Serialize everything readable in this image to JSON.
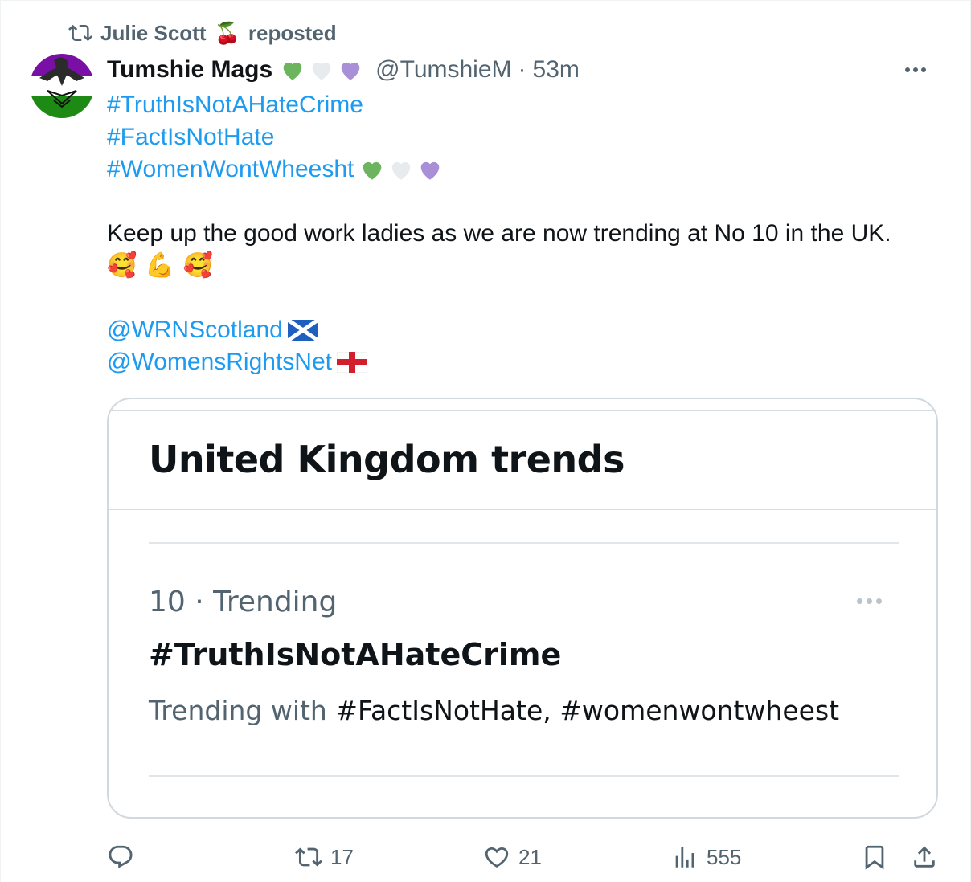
{
  "social_context": {
    "user": "Julie Scott",
    "emoji": "🍒",
    "action": "reposted",
    "icon": "repost-icon"
  },
  "author": {
    "name": "Tumshie Mags",
    "handle": "@TumshieM",
    "separator": "·",
    "time": "53m",
    "name_hearts": [
      "#6cb45e",
      "#e8ebed",
      "#a98fd8"
    ]
  },
  "tweet": {
    "hashtag1": "#TruthIsNotAHateCrime",
    "hashtag2": "#FactIsNotHate",
    "hashtag3": "#WomenWontWheesht",
    "text": "Keep up the good work ladies as we are now trending at No 10 in the UK.",
    "emojis": [
      "🥰",
      "💪",
      "🥰"
    ],
    "mention1": "@WRNScotland",
    "mention2": "@WomensRightsNet"
  },
  "card": {
    "title": "United Kingdom trends",
    "rank": "10 · Trending",
    "trend": "#TruthIsNotAHateCrime",
    "with_label": "Trending with ",
    "with_tags": "#FactIsNotHate, #womenwontwheest"
  },
  "actions": {
    "replies": "",
    "reposts": "17",
    "likes": "21",
    "views": "555"
  },
  "colors": {
    "link": "#1d9bf0",
    "muted": "#536471",
    "text": "#0f1419",
    "avatar_top": "#7a0fa6",
    "avatar_bottom": "#1d8a14"
  }
}
